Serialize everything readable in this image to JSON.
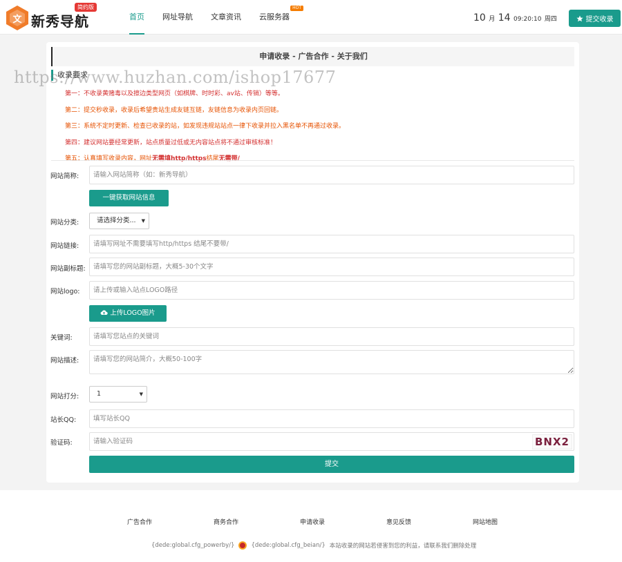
{
  "header": {
    "logo_text": "新秀导航",
    "logo_badge": "简约版",
    "nav": [
      {
        "label": "首页",
        "active": true
      },
      {
        "label": "网址导航"
      },
      {
        "label": "文章资讯"
      },
      {
        "label": "云服务器",
        "badge": "HOT"
      }
    ],
    "date_month": "10",
    "date_month_unit": "月",
    "date_day": "14",
    "time": "09:20:10",
    "weekday": "周四",
    "submit_label": "提交收录"
  },
  "card": {
    "title": "申请收录 - 广告合作 - 关于我们",
    "rules_title": "收录要求",
    "rules": [
      {
        "prefix": "第一：",
        "text": "不收录黄赌毒以及擦边类型网页（如棋牌、时时彩、av站、传销）等等。"
      },
      {
        "prefix": "第二：",
        "text": "提交秒收录，收录后希望贵站生成友链互链，友链信息为收录内页回链。"
      },
      {
        "prefix": "第三：",
        "text": "系统不定时更新、检查已收录的站，如发现违规站站点一律下收录并拉入黑名单不再通过收录。"
      },
      {
        "prefix": "第四：",
        "text": "建议网站要经常更新，站点质量过低或无内容站点将不通过审核标准！"
      },
      {
        "prefix": "第五：",
        "text_a": "认真填写收录内容，网址",
        "text_b": "无需填http/https",
        "text_c": "结尾",
        "text_d": "无需带/"
      }
    ],
    "watermark": "https://www.huzhan.com/ishop17677"
  },
  "form": {
    "site_name": {
      "label": "网站简称:",
      "placeholder": "请输入网站简称（如：新秀导航）"
    },
    "fetch_btn": "一键获取网站信息",
    "category": {
      "label": "网站分类:",
      "selected": "请选择分类..."
    },
    "site_url": {
      "label": "网站链接:",
      "placeholder": "请填写网址不需要填写http/https 结尾不要带/"
    },
    "subtitle": {
      "label": "网站副标题:",
      "placeholder": "请填写您的网站副标题，大概5-30个文字"
    },
    "logo": {
      "label": "网站logo:",
      "placeholder": "请上传或输入站点LOGO路径"
    },
    "upload_btn": "上传LOGO图片",
    "keywords": {
      "label": "关键词:",
      "placeholder": "请填写您站点的关键词"
    },
    "description": {
      "label": "网站描述:",
      "placeholder": "请填写您的网站简介，大概50-100字"
    },
    "rating": {
      "label": "网站打分:",
      "selected": "1"
    },
    "qq": {
      "label": "站长QQ:",
      "placeholder": "填写站长QQ"
    },
    "captcha": {
      "label": "验证码:",
      "placeholder": "请输入验证码",
      "image_text": "BNX2"
    },
    "submit": "提交"
  },
  "footer": {
    "links": [
      "广告合作",
      "商务合作",
      "申请收录",
      "意见反馈",
      "网站地图"
    ],
    "powerby": "{dede:global.cfg_powerby/}",
    "beian": "{dede:global.cfg_beian/}",
    "notice": "本站收录的网站若侵害到您的利益，请联系我们删除处理"
  },
  "colors": {
    "accent": "#1a9b8c",
    "rule_red": "#d32f2f",
    "rule_orange": "#e65100"
  }
}
